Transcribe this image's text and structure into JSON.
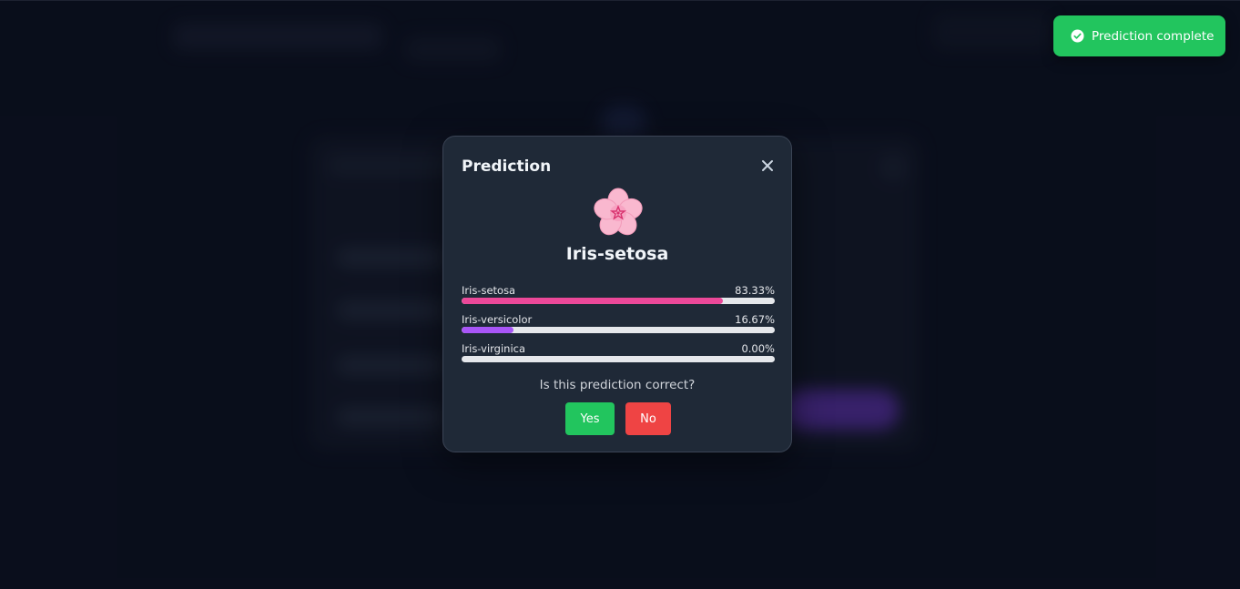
{
  "modal": {
    "title": "Prediction",
    "icon": "flower-icon",
    "predicted_class": "Iris-setosa",
    "probabilities": [
      {
        "label": "Iris-setosa",
        "value_text": "83.33%",
        "value": 83.33,
        "color": "#ec4899"
      },
      {
        "label": "Iris-versicolor",
        "value_text": "16.67%",
        "value": 16.67,
        "color": "#a855f7"
      },
      {
        "label": "Iris-virginica",
        "value_text": "0.00%",
        "value": 0.0,
        "color": "#ec4899"
      }
    ],
    "question": "Is this prediction correct?",
    "yes_label": "Yes",
    "no_label": "No"
  },
  "toast": {
    "icon": "check-circle-icon",
    "message": "Prediction complete"
  },
  "colors": {
    "success": "#22c55e",
    "danger": "#ef4444",
    "modal_bg": "#1f2937"
  }
}
